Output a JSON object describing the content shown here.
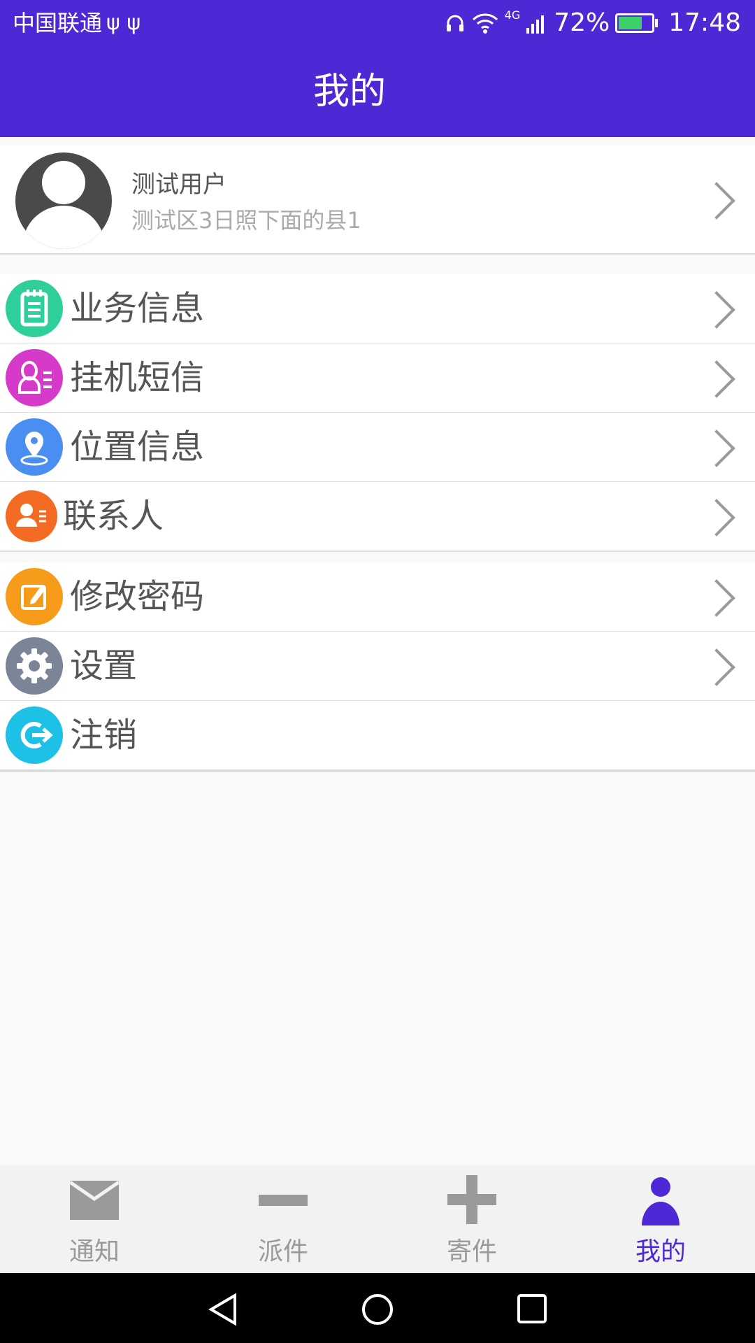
{
  "status_bar": {
    "carrier": "中国联通",
    "usb_icons": "ψ ψ",
    "network": "4G",
    "battery_percent": "72%",
    "battery_level": 0.72,
    "time": "17:48"
  },
  "header": {
    "title": "我的"
  },
  "profile": {
    "name": "测试用户",
    "area": "测试区3日照下面的县1"
  },
  "menu_groups": [
    {
      "items": [
        {
          "label": "业务信息",
          "icon": "notepad-icon",
          "color": "#2ecf9a"
        },
        {
          "label": "挂机短信",
          "icon": "person-list-icon",
          "color": "#d63ac9"
        },
        {
          "label": "位置信息",
          "icon": "location-pin-icon",
          "color": "#4a8ef2"
        },
        {
          "label": "联系人",
          "icon": "contact-card-icon",
          "color": "#f36a22"
        }
      ]
    },
    {
      "items": [
        {
          "label": "修改密码",
          "icon": "edit-icon",
          "color": "#f79b1a"
        },
        {
          "label": "设置",
          "icon": "gear-icon",
          "color": "#7b8597"
        },
        {
          "label": "注销",
          "icon": "logout-icon",
          "color": "#1dc1e5"
        }
      ]
    }
  ],
  "bottom_nav": [
    {
      "label": "通知",
      "icon": "envelope-icon",
      "active": false
    },
    {
      "label": "派件",
      "icon": "minus-icon",
      "active": false
    },
    {
      "label": "寄件",
      "icon": "plus-icon",
      "active": false
    },
    {
      "label": "我的",
      "icon": "person-icon",
      "active": true
    }
  ],
  "colors": {
    "primary": "#4f28d6",
    "inactive": "#9a9a9a"
  }
}
